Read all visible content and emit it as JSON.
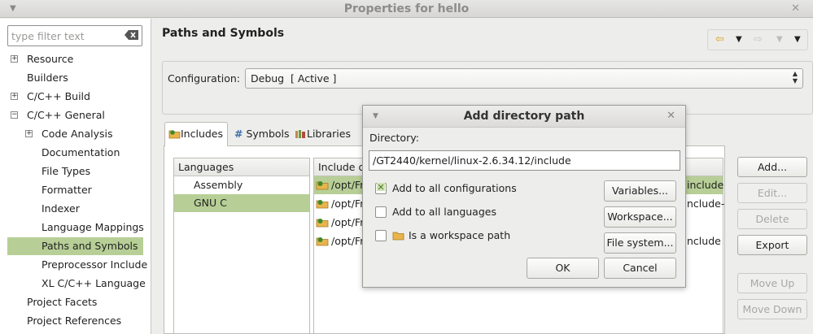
{
  "window": {
    "title": "Properties for hello"
  },
  "filter": {
    "placeholder": "type filter text"
  },
  "tree": [
    {
      "label": "Resource",
      "expander": "+"
    },
    {
      "label": "Builders"
    },
    {
      "label": "C/C++ Build",
      "expander": "+"
    },
    {
      "label": "C/C++ General",
      "expander": "−"
    },
    {
      "label": "Code Analysis",
      "expander": "+"
    },
    {
      "label": "Documentation"
    },
    {
      "label": "File Types"
    },
    {
      "label": "Formatter"
    },
    {
      "label": "Indexer"
    },
    {
      "label": "Language Mappings"
    },
    {
      "label": "Paths and Symbols",
      "selected": true
    },
    {
      "label": "Preprocessor Include"
    },
    {
      "label": "XL C/C++ Language"
    },
    {
      "label": "Project Facets"
    },
    {
      "label": "Project References"
    }
  ],
  "page": {
    "title": "Paths and Symbols"
  },
  "configuration": {
    "label": "Configuration:",
    "value": "Debug  [ Active ]"
  },
  "tabs": [
    {
      "label": "Includes",
      "icon": "includes-folder-icon"
    },
    {
      "label": "Symbols",
      "icon": "hash-icon",
      "glyph": "#"
    },
    {
      "label": "Libraries",
      "icon": "libraries-icon"
    }
  ],
  "languages": {
    "header": "Languages",
    "items": [
      "Assembly",
      "GNU C"
    ],
    "selected_index": 1
  },
  "includes": {
    "header": "Include d",
    "rows": [
      {
        "path": "/opt/Fr",
        "tail": "include"
      },
      {
        "path": "/opt/Fr",
        "tail": "nclude-"
      },
      {
        "path": "/opt/Fr",
        "tail": ""
      },
      {
        "path": "/opt/Fr",
        "tail": "nclude"
      }
    ]
  },
  "side_buttons": {
    "add": "Add...",
    "edit": "Edit...",
    "delete": "Delete",
    "export": "Export",
    "move_up": "Move Up",
    "move_down": "Move Down"
  },
  "dialog": {
    "title": "Add directory path",
    "directory_label": "Directory:",
    "directory_value": "/GT2440/kernel/linux-2.6.34.12/include",
    "add_all_configs": {
      "label": "Add to all configurations",
      "checked": true
    },
    "add_all_languages": {
      "label": "Add to all languages",
      "checked": false
    },
    "workspace_path": {
      "label": "Is a workspace path",
      "checked": false
    },
    "variables": "Variables...",
    "workspace": "Workspace...",
    "file_system": "File system...",
    "ok": "OK",
    "cancel": "Cancel"
  },
  "colors": {
    "selection": "#b7cf96",
    "folder": "#e9b44c",
    "leaf": "#3d8a2c"
  }
}
